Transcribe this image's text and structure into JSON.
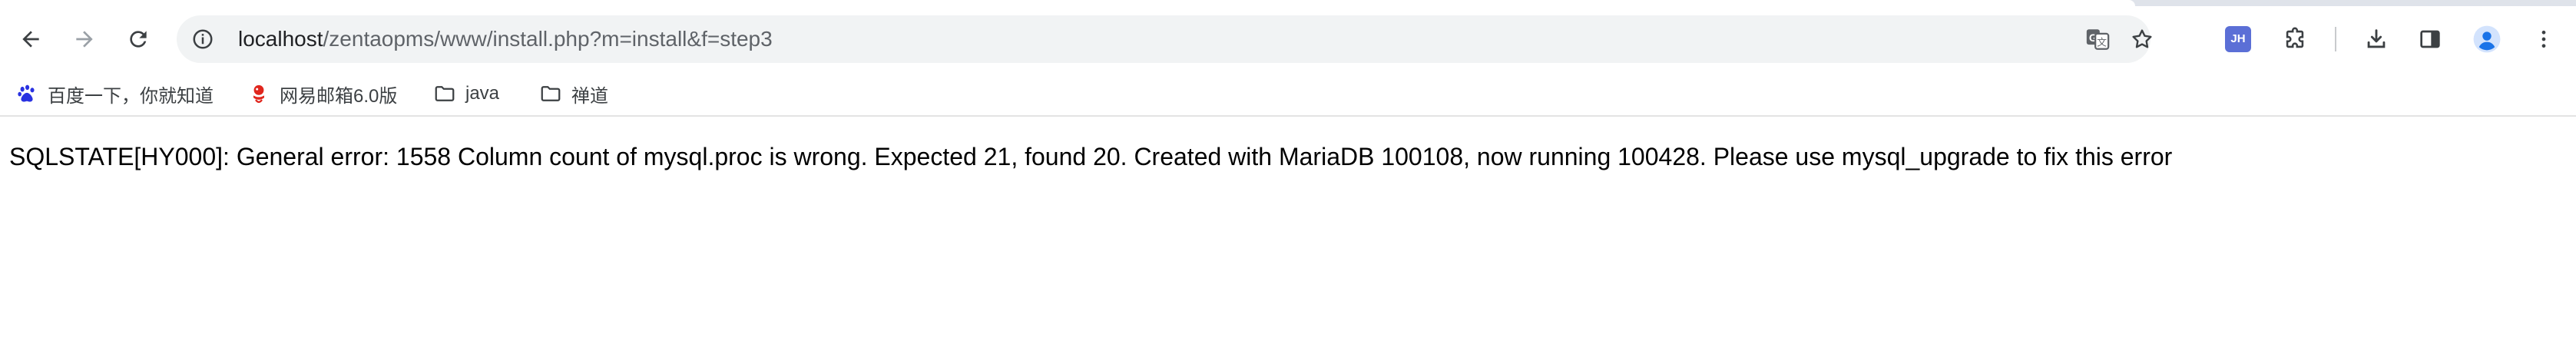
{
  "browser": {
    "address_bar": {
      "host": "localhost",
      "path": "/zentaopms/www/install.php?m=install&f=step3"
    },
    "extensions": {
      "jh_label": "JH"
    },
    "accent_color": "#5b6fd6",
    "profile_color": "#1a73e8"
  },
  "bookmarks": [
    {
      "label": "百度一下，你就知道",
      "icon": "baidu-paw-icon"
    },
    {
      "label": "网易邮箱6.0版",
      "icon": "netease-mail-icon"
    },
    {
      "label": "java",
      "icon": "folder-icon"
    },
    {
      "label": "禅道",
      "icon": "folder-icon"
    }
  ],
  "page": {
    "error_text": "SQLSTATE[HY000]: General error: 1558 Column count of mysql.proc is wrong. Expected 21, found 20. Created with MariaDB 100108, now running 100428. Please use mysql_upgrade to fix this error"
  }
}
